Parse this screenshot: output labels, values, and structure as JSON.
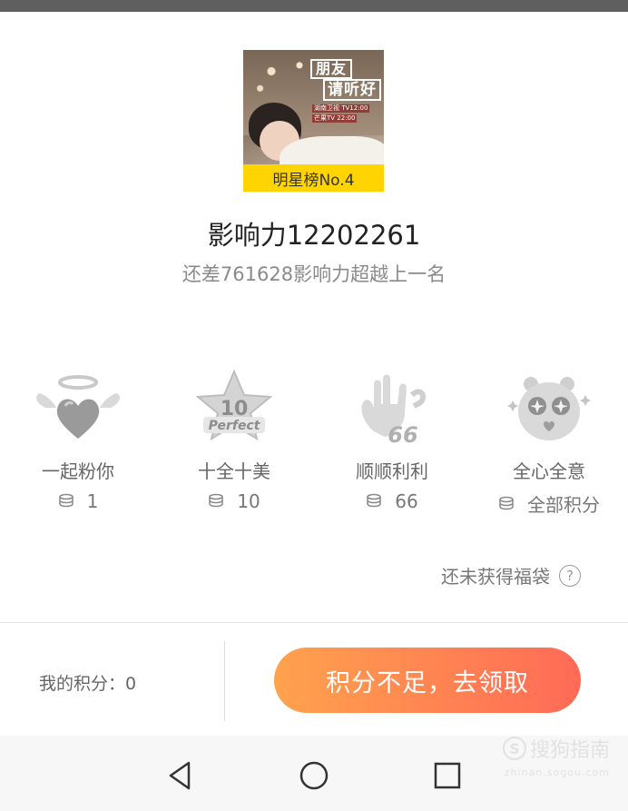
{
  "poster": {
    "logo_line1": "朋友",
    "logo_line2": "请听好",
    "air_line1": "湖南卫视 TV12:00",
    "air_line2": "芒果TV 22:00",
    "rank_label": "明星榜No.4"
  },
  "stats": {
    "influence": "影响力12202261",
    "gap": "还差761628影响力超越上一名"
  },
  "gifts": [
    {
      "name": "一起粉你",
      "cost": "1",
      "icon": "heart-with-wings-icon"
    },
    {
      "name": "十全十美",
      "cost": "10",
      "icon": "perfect-10-star-icon"
    },
    {
      "name": "顺顺利利",
      "cost": "66",
      "icon": "hand-66-icon"
    },
    {
      "name": "全心全意",
      "cost": "全部积分",
      "icon": "sparkle-panda-icon"
    }
  ],
  "lucky_bag": {
    "status": "还未获得福袋",
    "help": "?"
  },
  "footer": {
    "my_points": "我的积分：0",
    "claim_button": "积分不足，去领取"
  },
  "watermark": {
    "logo_letter": "S",
    "brand": "搜狗指南",
    "url": "zhinan.sogou.com"
  },
  "colors": {
    "accent_start": "#ffa24d",
    "accent_end": "#ff6a57",
    "rank_band": "#ffd400"
  }
}
